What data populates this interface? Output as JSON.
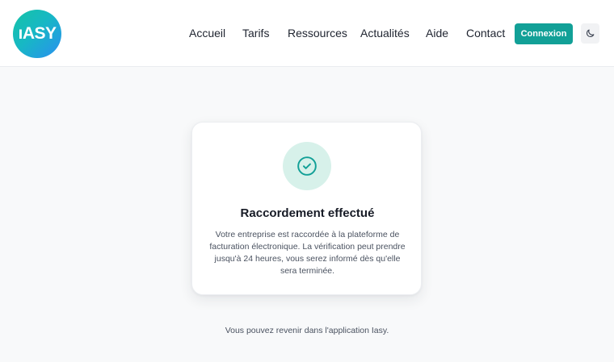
{
  "header": {
    "logo_text": "ıASY",
    "nav": [
      {
        "label": "Accueil"
      },
      {
        "label": "Tarifs"
      },
      {
        "label": "Ressources"
      },
      {
        "label": "Actualités"
      },
      {
        "label": "Aide"
      },
      {
        "label": "Contact"
      }
    ],
    "login_label": "Connexion",
    "theme_toggle_icon": "moon-icon"
  },
  "card": {
    "icon": "check-circle-icon",
    "title": "Raccordement effectué",
    "body": "Votre entreprise est raccordée à la plateforme de facturation électronique. La vérification peut prendre jusqu'à 24 heures, vous serez informé dès qu'elle sera terminée."
  },
  "footer_note": "Vous pouvez revenir dans l'application Iasy.",
  "colors": {
    "accent": "#12a097",
    "check_bg": "#d7f1ea",
    "check_stroke": "#12a097"
  }
}
